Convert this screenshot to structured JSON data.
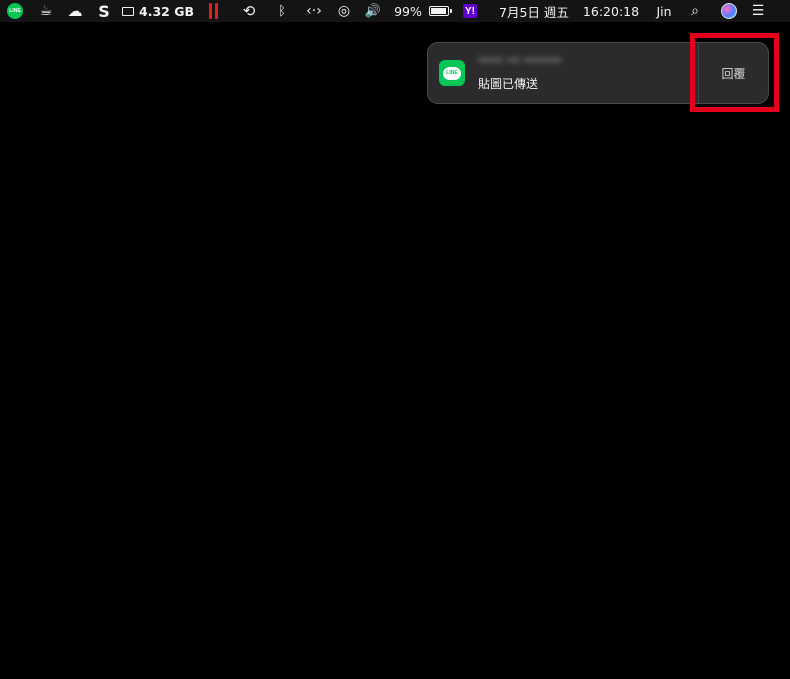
{
  "menubar": {
    "items": [
      {
        "name": "line-app-icon",
        "text": "LINE"
      },
      {
        "name": "coffee-icon"
      },
      {
        "name": "cloud-upload-icon"
      },
      {
        "name": "scrivener-icon",
        "text": "S"
      },
      {
        "name": "memory-monitor",
        "text": "4.32 GB"
      },
      {
        "name": "pause-icon"
      },
      {
        "name": "time-machine-icon"
      },
      {
        "name": "bluetooth-icon"
      },
      {
        "name": "code-icon"
      },
      {
        "name": "wifi-icon"
      },
      {
        "name": "volume-icon"
      },
      {
        "name": "battery-percent",
        "text": "99%"
      },
      {
        "name": "battery-icon",
        "level": 0.99
      },
      {
        "name": "yahoo-icon",
        "text": "Y!"
      },
      {
        "name": "date",
        "text": "7月5日 週五"
      },
      {
        "name": "clock",
        "text": "16:20:18"
      },
      {
        "name": "user-name",
        "text": "Jin"
      },
      {
        "name": "spotlight-search-icon"
      },
      {
        "name": "siri-icon"
      },
      {
        "name": "notification-center-icon"
      }
    ]
  },
  "notification": {
    "app_icon_label": "LINE",
    "title": "**** ** ******",
    "body": "貼圖已傳送",
    "action_label": "回覆"
  },
  "annotation": {
    "color": "#e4001b"
  }
}
